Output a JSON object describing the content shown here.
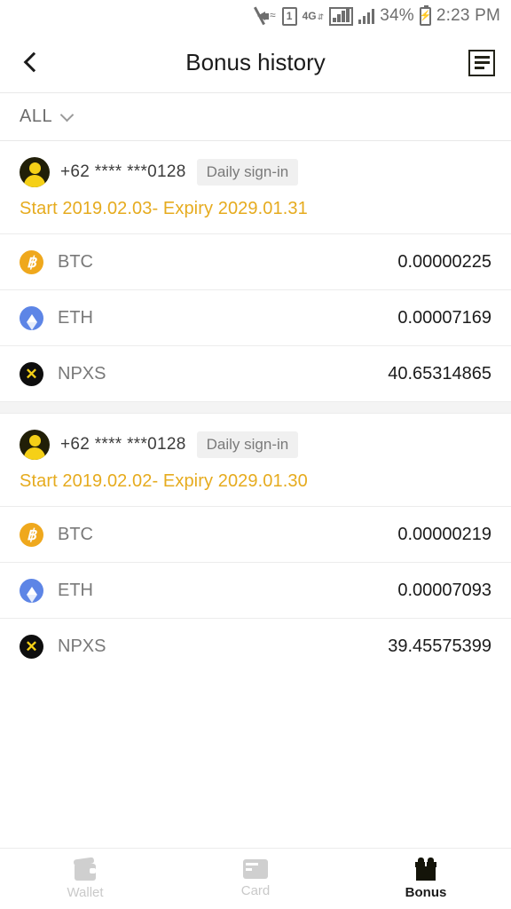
{
  "statusbar": {
    "mute_icon": "mute-icon",
    "sim_badge": "1",
    "network": "4G",
    "network_arrows": "⇵",
    "battery_percent": "34%",
    "time": "2:23 PM"
  },
  "header": {
    "back_icon": "chevron-left-icon",
    "title": "Bonus history",
    "rules_icon": "rules-list-icon"
  },
  "filter": {
    "label": "ALL",
    "chevron": "chevron-down-icon"
  },
  "colors": {
    "accent_amber": "#e6ab1e",
    "btc": "#efa81d",
    "eth": "#5d85e6",
    "npxs": "#0e0e0e",
    "spacer": "#f4f4f4"
  },
  "groups": [
    {
      "avatar": "user-avatar",
      "phone": "+62 **** ***0128",
      "tag": "Daily sign-in",
      "dates": "Start 2019.02.03- Expiry 2029.01.31",
      "coins": [
        {
          "symbol": "BTC",
          "amount": "0.00000225",
          "icon": "btc-icon",
          "glyph": "฿"
        },
        {
          "symbol": "ETH",
          "amount": "0.00007169",
          "icon": "eth-icon",
          "glyph": ""
        },
        {
          "symbol": "NPXS",
          "amount": "40.65314865",
          "icon": "npxs-icon",
          "glyph": "✕"
        }
      ]
    },
    {
      "avatar": "user-avatar",
      "phone": "+62 **** ***0128",
      "tag": "Daily sign-in",
      "dates": "Start 2019.02.02- Expiry 2029.01.30",
      "coins": [
        {
          "symbol": "BTC",
          "amount": "0.00000219",
          "icon": "btc-icon",
          "glyph": "฿"
        },
        {
          "symbol": "ETH",
          "amount": "0.00007093",
          "icon": "eth-icon",
          "glyph": ""
        },
        {
          "symbol": "NPXS",
          "amount": "39.45575399",
          "icon": "npxs-icon",
          "glyph": "✕"
        }
      ]
    }
  ],
  "bottomnav": {
    "items": [
      {
        "label": "Wallet",
        "icon": "wallet-icon",
        "active": false
      },
      {
        "label": "Card",
        "icon": "card-icon",
        "active": false
      },
      {
        "label": "Bonus",
        "icon": "gift-icon",
        "active": true
      }
    ]
  }
}
